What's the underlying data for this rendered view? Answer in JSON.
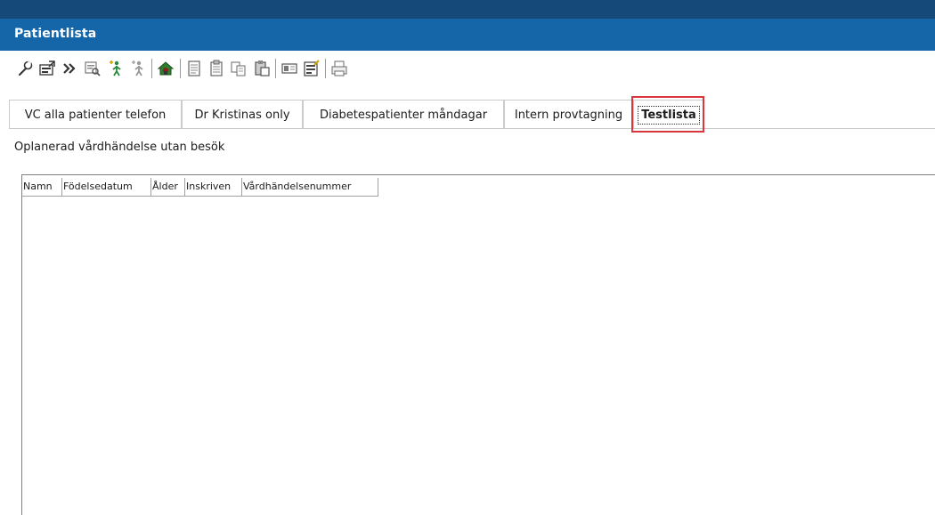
{
  "window": {
    "title": "Patientlista"
  },
  "toolbar": {
    "icons": [
      "wrench-icon",
      "properties-icon",
      "forward-icon",
      "search-record-icon",
      "person-add-icon",
      "person-icon",
      "home-icon",
      "document-icon",
      "clipboard-icon",
      "copy-icon",
      "paste-icon",
      "card-icon",
      "edit-form-icon",
      "print-icon"
    ]
  },
  "tabs": [
    {
      "label": "VC alla patienter telefon",
      "active": false
    },
    {
      "label": "Dr Kristinas only",
      "active": false
    },
    {
      "label": "Diabetespatienter måndagar",
      "active": false
    },
    {
      "label": "Intern provtagning",
      "active": false
    },
    {
      "label": "Testlista",
      "active": true
    }
  ],
  "list": {
    "description": "Oplanerad vårdhändelse utan besök"
  },
  "table": {
    "columns": [
      "Namn",
      "Födelsedatum",
      "Ålder",
      "Inskriven",
      "Vårdhändelsenummer"
    ],
    "rows": []
  },
  "colors": {
    "title_bar": "#1566a8",
    "top_strip": "#14497a",
    "highlight": "#d9363e"
  }
}
